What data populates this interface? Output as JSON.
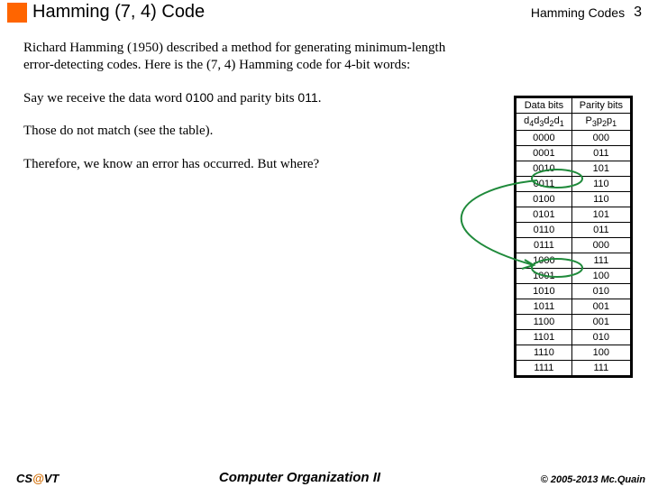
{
  "header": {
    "title": "Hamming (7, 4) Code",
    "topic": "Hamming Codes",
    "page": "3"
  },
  "body": {
    "intro": "Richard Hamming (1950) described a method for generating minimum-length error-detecting codes.  Here is the (7, 4) Hamming code for 4-bit words:",
    "p1a": "Say we receive the data word ",
    "p1b": "0100",
    "p1c": " and parity bits ",
    "p1d": "011",
    "p1e": ".",
    "p2": "Those do not match (see the table).",
    "p3": "Therefore, we know an error has occurred.  But where?"
  },
  "table": {
    "col1": "Data bits",
    "col2": "Parity bits",
    "rows": [
      {
        "d": "0000",
        "p": "000"
      },
      {
        "d": "0001",
        "p": "011"
      },
      {
        "d": "0010",
        "p": "101"
      },
      {
        "d": "0011",
        "p": "110"
      },
      {
        "d": "0100",
        "p": "110"
      },
      {
        "d": "0101",
        "p": "101"
      },
      {
        "d": "0110",
        "p": "011"
      },
      {
        "d": "0111",
        "p": "000"
      },
      {
        "d": "1000",
        "p": "111"
      },
      {
        "d": "1001",
        "p": "100"
      },
      {
        "d": "1010",
        "p": "010"
      },
      {
        "d": "1011",
        "p": "001"
      },
      {
        "d": "1100",
        "p": "001"
      },
      {
        "d": "1101",
        "p": "010"
      },
      {
        "d": "1110",
        "p": "100"
      },
      {
        "d": "1111",
        "p": "111"
      }
    ]
  },
  "footer": {
    "left_a": "CS",
    "left_at": "@",
    "left_b": "VT",
    "center": "Computer Organization II",
    "right": "© 2005-2013 Mc.Quain"
  },
  "chart_data": {
    "type": "table",
    "title": "Hamming (7,4) code table",
    "columns": [
      "Data bits d4d3d2d1",
      "Parity bits P3p2p1"
    ],
    "rows": [
      [
        "0000",
        "000"
      ],
      [
        "0001",
        "011"
      ],
      [
        "0010",
        "101"
      ],
      [
        "0011",
        "110"
      ],
      [
        "0100",
        "110"
      ],
      [
        "0101",
        "101"
      ],
      [
        "0110",
        "011"
      ],
      [
        "0111",
        "000"
      ],
      [
        "1000",
        "111"
      ],
      [
        "1001",
        "100"
      ],
      [
        "1010",
        "010"
      ],
      [
        "1011",
        "001"
      ],
      [
        "1100",
        "001"
      ],
      [
        "1101",
        "010"
      ],
      [
        "1110",
        "100"
      ],
      [
        "1111",
        "111"
      ]
    ]
  }
}
